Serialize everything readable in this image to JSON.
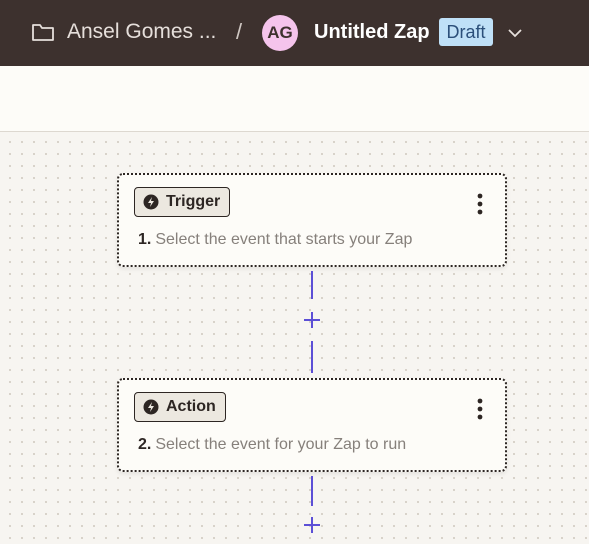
{
  "header": {
    "folder_name": "Ansel Gomes ...",
    "separator": "/",
    "avatar_initials": "AG",
    "zap_title": "Untitled Zap",
    "status_badge": "Draft"
  },
  "steps": [
    {
      "type_label": "Trigger",
      "number": "1.",
      "description": "Select the event that starts your Zap",
      "icon": "bolt-icon"
    },
    {
      "type_label": "Action",
      "number": "2.",
      "description": "Select the event for your Zap to run",
      "icon": "bolt-icon"
    }
  ],
  "colors": {
    "header_bg": "#3d312e",
    "avatar_bg": "#f5c4ec",
    "draft_bg": "#bfe0f7",
    "connector": "#5c4fd6",
    "canvas_bg": "#f7f5f1"
  },
  "icons": [
    "folder-icon",
    "chevron-down-icon",
    "bolt-icon",
    "more-icon",
    "add-step-icon"
  ]
}
